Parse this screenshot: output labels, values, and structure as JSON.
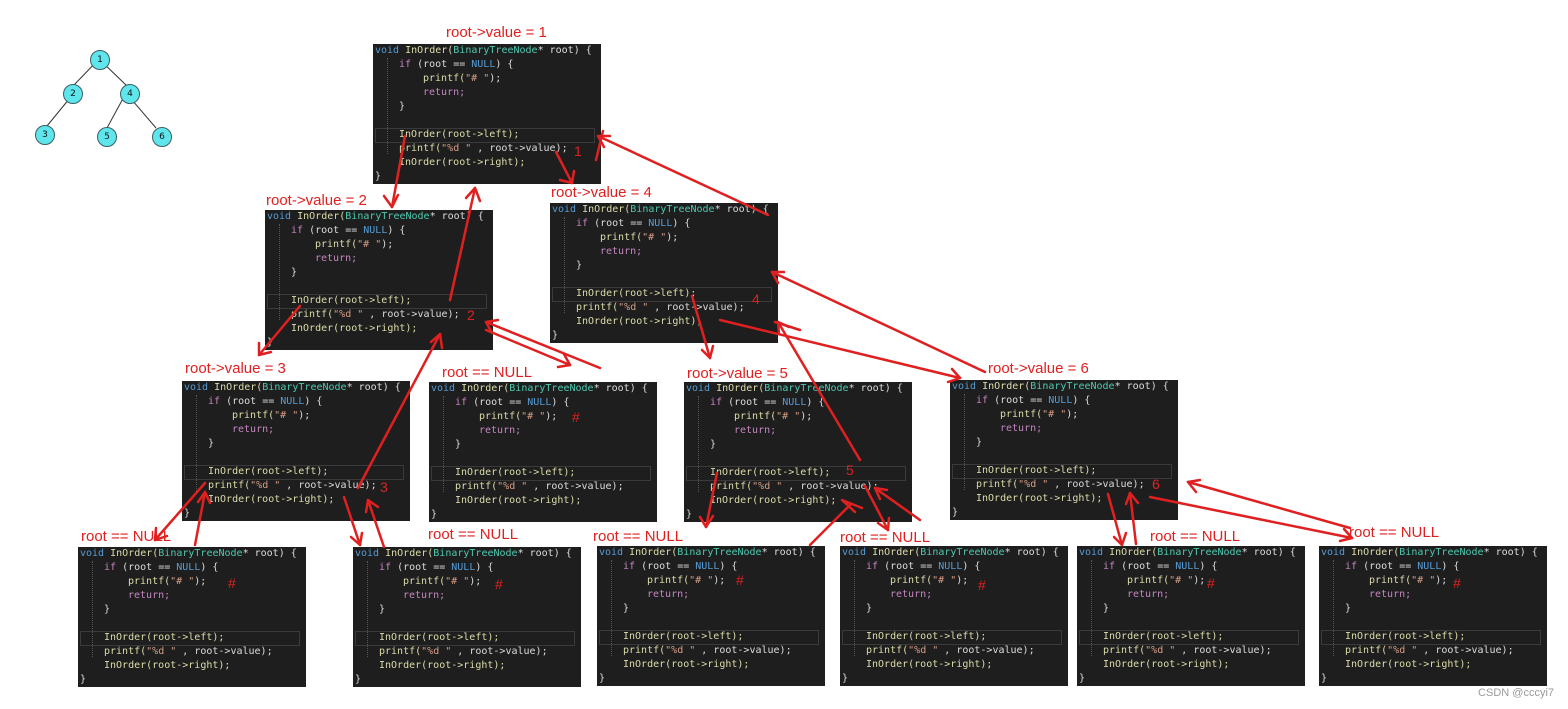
{
  "tree": {
    "nodes": [
      {
        "id": "n1",
        "label": "1"
      },
      {
        "id": "n2",
        "label": "2"
      },
      {
        "id": "n4",
        "label": "4"
      },
      {
        "id": "n3",
        "label": "3"
      },
      {
        "id": "n5",
        "label": "5"
      },
      {
        "id": "n6",
        "label": "6"
      }
    ]
  },
  "code": {
    "l1a": "void",
    "l1b": " InOrder(",
    "l1c": "BinaryTreeNode",
    "l1d": "* root) {",
    "l2a": "if",
    "l2b": " (root == ",
    "l2c": "NULL",
    "l2d": ") {",
    "l3a": "printf(",
    "l3b": "\"# \"",
    "l3c": ");",
    "l4": "return;",
    "l5": "}",
    "l6": "InOrder(root->left);",
    "l7a": "printf(",
    "l7b": "\"%d \"",
    "l7c": " , root->value);",
    "l8": "InOrder(root->right);",
    "l9": "}"
  },
  "labels": {
    "root1": "root->value = 1",
    "root2": "root->value = 2",
    "root4": "root->value = 4",
    "root3": "root->value = 3",
    "null_a": "root == NULL",
    "root5": "root->value = 5",
    "root6": "root->value = 6",
    "null_b": "root == NULL",
    "null_c": "root == NULL",
    "null_d": "root == NULL",
    "null_e": "root == NULL",
    "null_f": "root == NULL",
    "null_g": "root == NULL"
  },
  "marks": {
    "m1": "1",
    "m2": "2",
    "m3": "3",
    "m4": "4",
    "m5": "5",
    "m6": "6",
    "hash": "#"
  },
  "watermark": "CSDN @cccyi7"
}
